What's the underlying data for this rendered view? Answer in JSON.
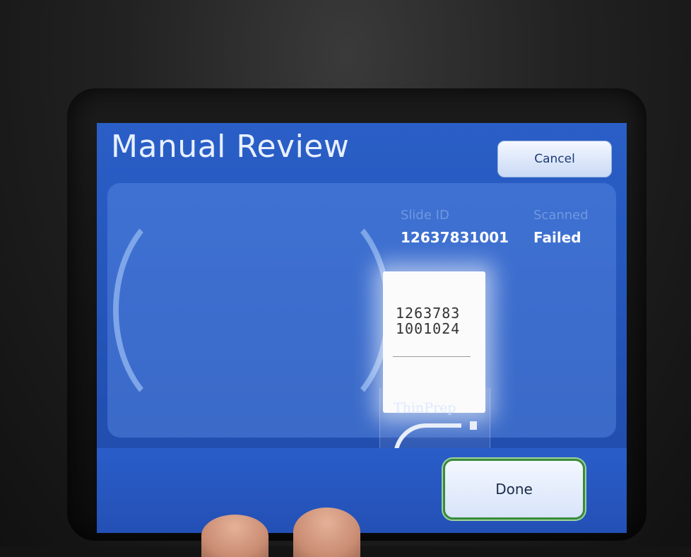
{
  "screen": {
    "title": "Manual Review",
    "cancel_label": "Cancel",
    "done_label": "Done"
  },
  "slide_info": {
    "slide_id_label": "Slide ID",
    "slide_id_value": "12637831001",
    "scanned_label": "Scanned",
    "scanned_value": "Failed"
  },
  "physical_slide": {
    "label_line1": "1263783",
    "label_line2": "1001024",
    "brand_text": "ThinPrep"
  },
  "colors": {
    "screen_bg": "#2454b8",
    "done_border": "#3a8c3e"
  }
}
